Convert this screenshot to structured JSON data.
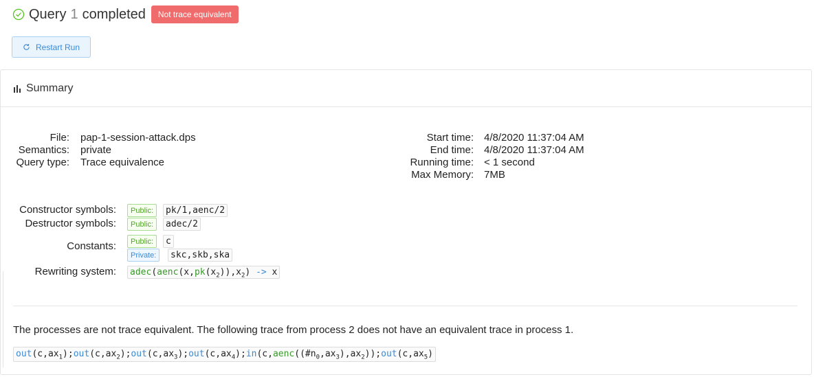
{
  "header": {
    "word_query": "Query",
    "number": "1",
    "word_completed": "completed",
    "badge": "Not trace equivalent"
  },
  "restart_label": "Restart Run",
  "panel_title": "Summary",
  "info_left": [
    {
      "label": "File:",
      "value": "pap-1-session-attack.dps"
    },
    {
      "label": "Semantics:",
      "value": "private"
    },
    {
      "label": "Query type:",
      "value": "Trace equivalence"
    }
  ],
  "info_right": [
    {
      "label": "Start time:",
      "value": "4/8/2020 11:37:04 AM"
    },
    {
      "label": "End time:",
      "value": "4/8/2020 11:37:04 AM"
    },
    {
      "label": "Running time:",
      "value": "< 1 second"
    },
    {
      "label": "Max Memory:",
      "value": "7MB"
    }
  ],
  "symbols": {
    "constructor_label": "Constructor symbols:",
    "constructor_tag": "Public:",
    "constructor_value": "pk/1,aenc/2",
    "destructor_label": "Destructor symbols:",
    "destructor_tag": "Public:",
    "destructor_value": "adec/2",
    "constants_label": "Constants:",
    "constants_public_tag": "Public:",
    "constants_public_value": "c",
    "constants_private_tag": "Private:",
    "constants_private_value": "skc,skb,ska",
    "rewriting_label": "Rewriting system:"
  },
  "description": "The processes are not trace equivalent. The following trace from process 2 does not have an equivalent trace in process 1."
}
